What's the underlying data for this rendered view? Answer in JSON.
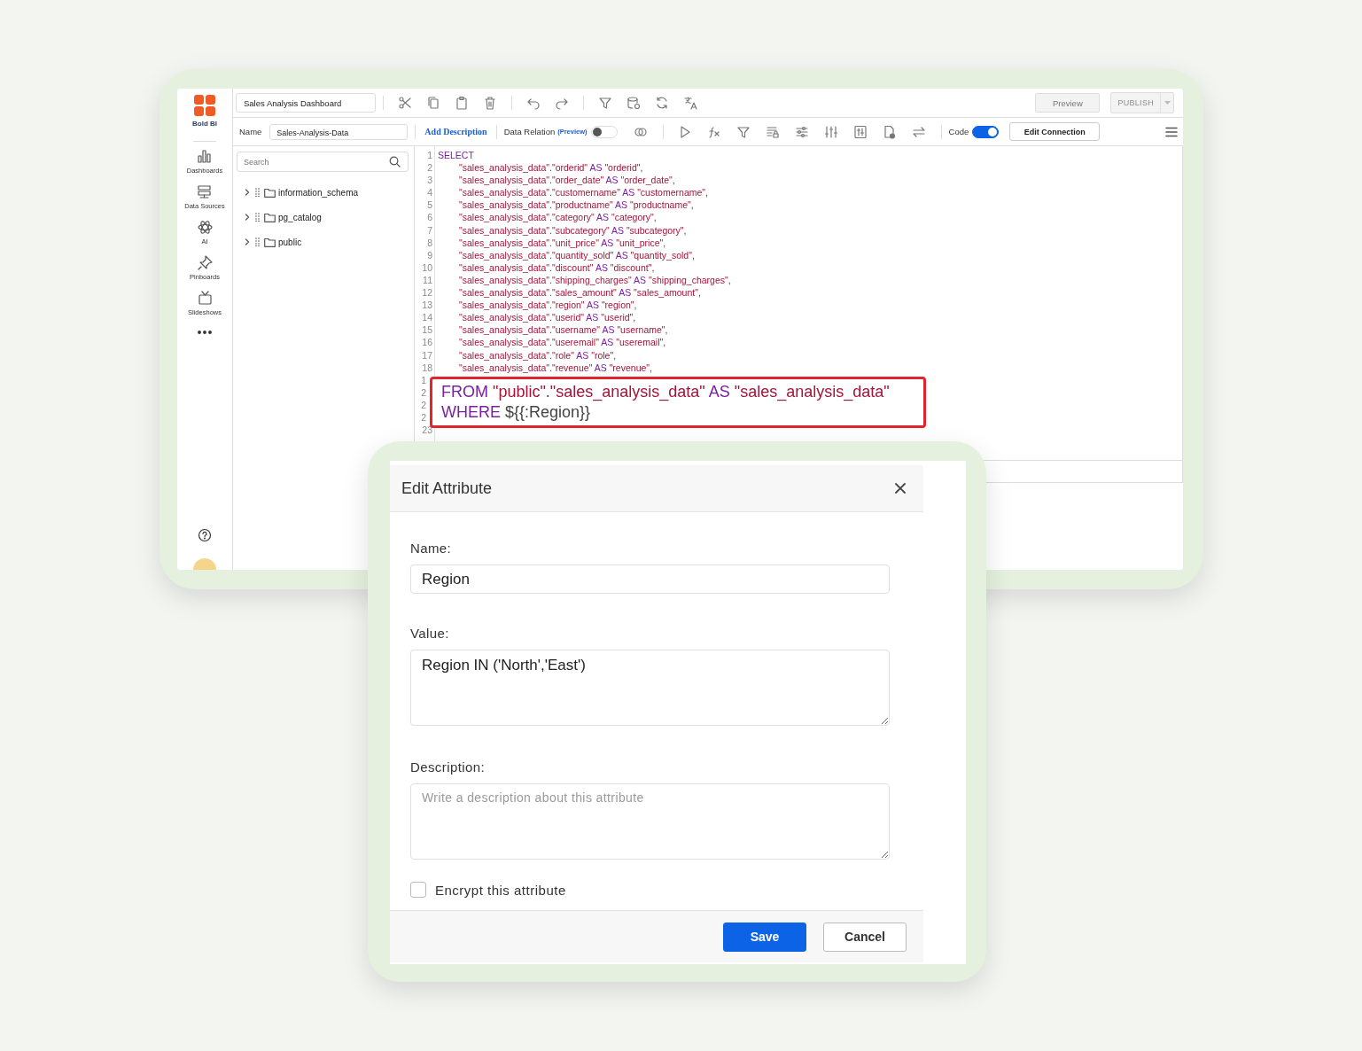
{
  "brand": {
    "name": "Bold BI"
  },
  "nav": [
    {
      "label": "Dashboards"
    },
    {
      "label": "Data Sources"
    },
    {
      "label": "AI"
    },
    {
      "label": "Pinboards"
    },
    {
      "label": "Slideshows"
    }
  ],
  "toolbar": {
    "dashboard_name": "Sales Analysis Dashboard",
    "preview": "Preview",
    "publish": "PUBLISH",
    "publish_disabled": true
  },
  "query_bar": {
    "name_label": "Name",
    "name_value": "Sales-Analysis-Data",
    "add_description": "Add Description",
    "data_relation": "Data Relation",
    "preview_tag": "(Preview)",
    "data_relation_on": false,
    "code_label": "Code",
    "code_on": true,
    "edit_connection": "Edit Connection"
  },
  "search": {
    "placeholder": "Search"
  },
  "tree": [
    {
      "label": "information_schema",
      "expanded": false
    },
    {
      "label": "pg_catalog",
      "expanded": false
    },
    {
      "label": "public",
      "expanded": false
    }
  ],
  "editor": {
    "lines": [
      {
        "number": "1",
        "code": "SELECT"
      },
      {
        "number": "2",
        "code": "\"sales_analysis_data\".\"orderid\" AS \"orderid\","
      },
      {
        "number": "3",
        "code": "\"sales_analysis_data\".\"order_date\" AS \"order_date\","
      },
      {
        "number": "4",
        "code": "\"sales_analysis_data\".\"customername\" AS \"customername\","
      },
      {
        "number": "5",
        "code": "\"sales_analysis_data\".\"productname\" AS \"productname\","
      },
      {
        "number": "6",
        "code": "\"sales_analysis_data\".\"category\" AS \"category\","
      },
      {
        "number": "7",
        "code": "\"sales_analysis_data\".\"subcategory\" AS \"subcategory\","
      },
      {
        "number": "8",
        "code": "\"sales_analysis_data\".\"unit_price\" AS \"unit_price\","
      },
      {
        "number": "9",
        "code": "\"sales_analysis_data\".\"quantity_sold\" AS \"quantity_sold\","
      },
      {
        "number": "10",
        "code": "\"sales_analysis_data\".\"discount\" AS \"discount\","
      },
      {
        "number": "11",
        "code": "\"sales_analysis_data\".\"shipping_charges\" AS \"shipping_charges\","
      },
      {
        "number": "12",
        "code": "\"sales_analysis_data\".\"sales_amount\" AS \"sales_amount\","
      },
      {
        "number": "13",
        "code": "\"sales_analysis_data\".\"region\" AS \"region\","
      },
      {
        "number": "14",
        "code": "\"sales_analysis_data\".\"userid\" AS \"userid\","
      },
      {
        "number": "15",
        "code": "\"sales_analysis_data\".\"username\" AS \"username\","
      },
      {
        "number": "16",
        "code": "\"sales_analysis_data\".\"useremail\" AS \"useremail\","
      },
      {
        "number": "17",
        "code": "\"sales_analysis_data\".\"role\" AS \"role\","
      },
      {
        "number": "18",
        "code": "\"sales_analysis_data\".\"revenue\" AS \"revenue\","
      },
      {
        "number": "1"
      },
      {
        "number": "2"
      },
      {
        "number": "2"
      },
      {
        "number": "2"
      },
      {
        "number": "23"
      }
    ]
  },
  "callout": {
    "lines": [
      "FROM \"public\".\"sales_analysis_data\" AS \"sales_analysis_data\"",
      "WHERE ${{:Region}}"
    ]
  },
  "dialog": {
    "title": "Edit Attribute",
    "fields": [
      {
        "label": "Name:",
        "kind": "input",
        "value": "Region"
      },
      {
        "label": "Value:",
        "kind": "textarea",
        "value": "Region IN ('North','East')"
      },
      {
        "label": "Description:",
        "kind": "textarea",
        "placeholder": "Write a description about this attribute"
      }
    ],
    "encrypt": {
      "label": "Encrypt this attribute",
      "checked": false
    },
    "buttons": [
      {
        "label": "Save",
        "kind": "primary"
      },
      {
        "label": "Cancel",
        "kind": "secondary"
      }
    ]
  }
}
